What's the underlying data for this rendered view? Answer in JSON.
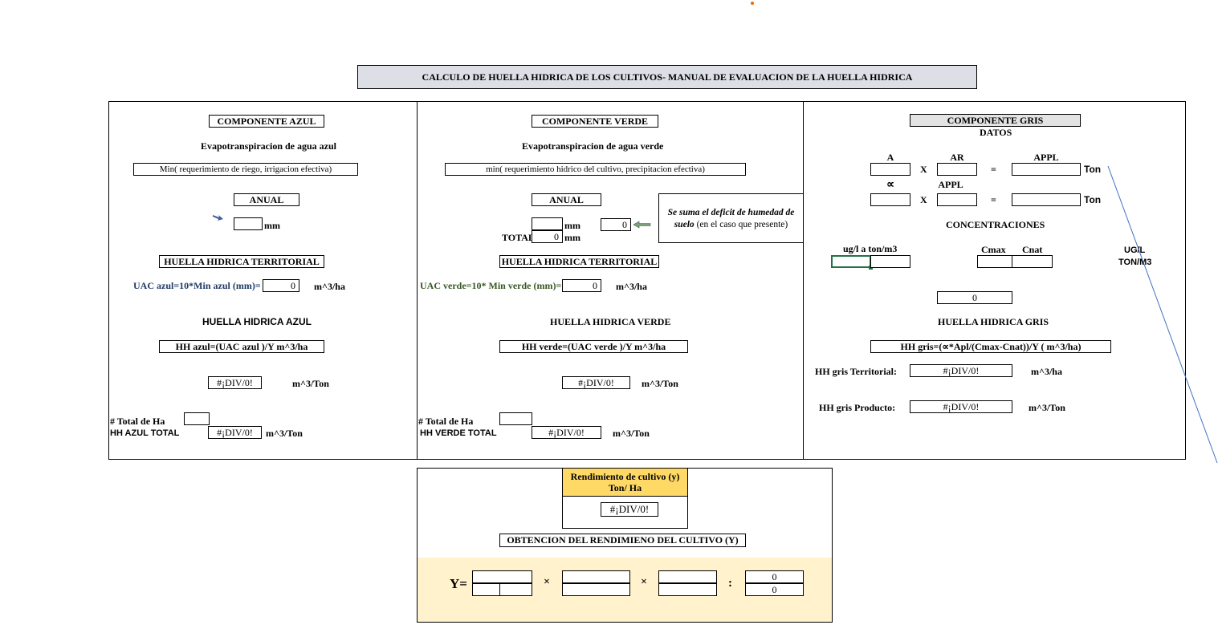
{
  "title": "CALCULO DE HUELLA HIDRICA DE LOS CULTIVOS- MANUAL DE EVALUACION DE LA HUELLA HIDRICA",
  "azul": {
    "header": "COMPONENTE AZUL",
    "evap": "Evapotranspiracion de agua azul",
    "formula_min": "Min( requerimiento de riego, irrigacion efectiva)",
    "anual": "ANUAL",
    "mm": "mm",
    "territorial": "HUELLA HIDRICA TERRITORIAL",
    "uac_label": "UAC azul=10*Min azul (mm)=",
    "uac_value": "0",
    "m3ha": "m^3/ha",
    "hh_title": "HUELLA HIDRICA AZUL",
    "hh_formula": "HH azul=(UAC azul )/Y  m^3/ha",
    "hh_value": "#¡DIV/0!",
    "m3ton": "m^3/Ton",
    "total_ha": "# Total de Ha",
    "hh_total": "HH AZUL TOTAL",
    "hh_total_value": "#¡DIV/0!",
    "hh_total_unit": "m^3/Ton"
  },
  "verde": {
    "header": "COMPONENTE VERDE",
    "evap": "Evapotranspiracion de agua verde",
    "formula_min": "min( requerimiento hidrico del cultivo, precipitacion efectiva)",
    "anual": "ANUAL",
    "mm": "mm",
    "total_label": "TOTAL",
    "total_value": "0",
    "deficit_value": "0",
    "note_italic": "Se suma el  deficit de humedad de suelo",
    "note_normal": " (en el caso que presente)",
    "territorial": "HUELLA HIDRICA TERRITORIAL",
    "uac_label": "UAC verde=10* Min verde (mm)=",
    "uac_value": "0",
    "m3ha": "m^3/ha",
    "hh_title": "HUELLA HIDRICA VERDE",
    "hh_formula": "HH verde=(UAC verde )/Y  m^3/ha",
    "hh_value": "#¡DIV/0!",
    "m3ton": "m^3/Ton",
    "total_ha": "# Total de Ha",
    "hh_total": "HH VERDE TOTAL",
    "hh_total_value": "#¡DIV/0!",
    "hh_total_unit": "m^3/Ton"
  },
  "gris": {
    "header": "COMPONENTE GRIS",
    "datos": "DATOS",
    "a": "A",
    "ar": "AR",
    "appl": "APPL",
    "x": "X",
    "eq": "=",
    "ton": "Ton",
    "alpha": "∝",
    "concentraciones": "CONCENTRACIONES",
    "ugl": "ug/l a ton/m3",
    "cmax": "Cmax",
    "cnat": "Cnat",
    "ugl_unit": "UG/L",
    "tonm3_unit": "TON/M3",
    "result": "0",
    "hh_title": "HUELLA HIDRICA GRIS",
    "hh_formula": "HH gris=(∝*Apl/(Cmax-Cnat))/Y ( m^3/ha)",
    "territorial_label": "HH gris Territorial:",
    "territorial_value": "#¡DIV/0!",
    "territorial_unit": "m^3/ha",
    "producto_label": "HH gris Producto:",
    "producto_value": "#¡DIV/0!",
    "producto_unit": "m^3/Ton"
  },
  "rendimiento": {
    "header": "Rendimiento de cultivo (y) Ton/ Ha",
    "value": "#¡DIV/0!",
    "obtencion": "OBTENCION DEL RENDIMIENO DEL CULTIVO (Y)",
    "y_label": "Y=",
    "times": "×",
    "colon": ":",
    "num_top": "0",
    "num_bottom": "0"
  },
  "colors": {
    "title_bg": "#dcdfe6",
    "gris_header_bg": "#e3e3e3",
    "rend_header_bg": "#ffd966",
    "rend_panel_bg": "#fff2cc",
    "azul_text": "#1f3864",
    "verde_text": "#385723",
    "selected_cell": "#217346",
    "line": "#4472c4"
  }
}
